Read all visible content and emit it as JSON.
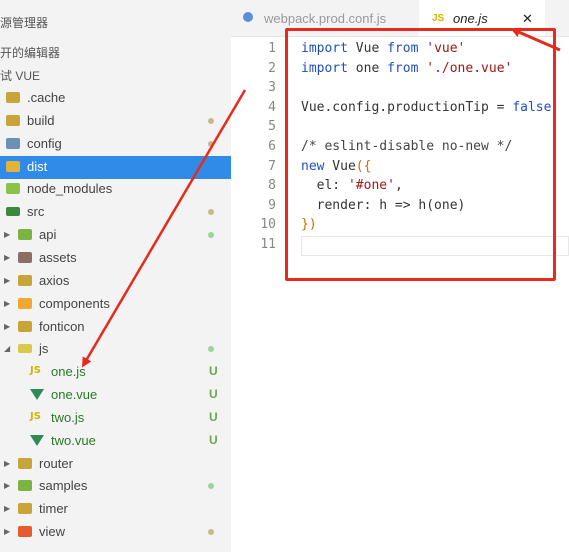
{
  "sidebar": {
    "header_title": "源管理器",
    "open_editors": "开的编辑器",
    "project": "试 VUE",
    "items": [
      {
        "label": ".cache",
        "depth": 0,
        "kind": "folder",
        "color": "#c9a43a"
      },
      {
        "label": "build",
        "depth": 0,
        "kind": "folder",
        "color": "#c9a43a",
        "status": "dot-y"
      },
      {
        "label": "config",
        "depth": 0,
        "kind": "folder",
        "color": "#6b8fb5",
        "status": "dot-y"
      },
      {
        "label": "dist",
        "depth": 0,
        "kind": "folder",
        "color": "#e0b33a",
        "selected": true
      },
      {
        "label": "node_modules",
        "depth": 0,
        "kind": "folder",
        "color": "#8bc34a"
      },
      {
        "label": "src",
        "depth": 0,
        "kind": "folder-open",
        "color": "#3b8a3b",
        "status": "dot-y"
      },
      {
        "label": "api",
        "depth": 1,
        "kind": "folder",
        "color": "#7cb342",
        "status": "dot-g"
      },
      {
        "label": "assets",
        "depth": 1,
        "kind": "folder",
        "color": "#8d6e63"
      },
      {
        "label": "axios",
        "depth": 1,
        "kind": "folder",
        "color": "#c9a43a"
      },
      {
        "label": "components",
        "depth": 1,
        "kind": "folder",
        "color": "#f0a830"
      },
      {
        "label": "fonticon",
        "depth": 1,
        "kind": "folder",
        "color": "#c9a43a"
      },
      {
        "label": "js",
        "depth": 1,
        "kind": "folder-open",
        "color": "#d9c84a",
        "status": "dot-g"
      },
      {
        "label": "one.js",
        "depth": 2,
        "kind": "js",
        "status": "U"
      },
      {
        "label": "one.vue",
        "depth": 2,
        "kind": "vue",
        "status": "U"
      },
      {
        "label": "two.js",
        "depth": 2,
        "kind": "js",
        "status": "U"
      },
      {
        "label": "two.vue",
        "depth": 2,
        "kind": "vue",
        "status": "U"
      },
      {
        "label": "router",
        "depth": 1,
        "kind": "folder",
        "color": "#c9a43a"
      },
      {
        "label": "samples",
        "depth": 1,
        "kind": "folder",
        "color": "#7cb342",
        "status": "dot-g"
      },
      {
        "label": "timer",
        "depth": 1,
        "kind": "folder",
        "color": "#c9a43a"
      },
      {
        "label": "view",
        "depth": 1,
        "kind": "folder",
        "color": "#e65c2e",
        "status": "dot-y"
      }
    ]
  },
  "tabs": [
    {
      "label": "webpack.prod.conf.js",
      "active": false
    },
    {
      "label": "one.js",
      "active": true,
      "prefix": "JS",
      "close": "✕"
    }
  ],
  "editor": {
    "line_numbers": [
      "1",
      "2",
      "3",
      "4",
      "5",
      "6",
      "7",
      "8",
      "9",
      "10",
      "11"
    ],
    "lines": [
      [
        {
          "t": "import",
          "c": "kw"
        },
        {
          "t": " Vue ",
          "c": ""
        },
        {
          "t": "from",
          "c": "kw"
        },
        {
          "t": " ",
          "c": ""
        },
        {
          "t": "'vue'",
          "c": "str"
        }
      ],
      [
        {
          "t": "import",
          "c": "kw"
        },
        {
          "t": " one ",
          "c": ""
        },
        {
          "t": "from",
          "c": "kw"
        },
        {
          "t": " ",
          "c": ""
        },
        {
          "t": "'./one.vue'",
          "c": "str"
        }
      ],
      [],
      [
        {
          "t": "Vue.config.productionTip = ",
          "c": ""
        },
        {
          "t": "false",
          "c": "kw"
        }
      ],
      [],
      [
        {
          "t": "/* eslint-disable no-new */",
          "c": "cmt"
        }
      ],
      [
        {
          "t": "new",
          "c": "kw"
        },
        {
          "t": " Vue",
          "c": ""
        },
        {
          "t": "({",
          "c": "br"
        }
      ],
      [
        {
          "t": "  el: ",
          "c": ""
        },
        {
          "t": "'#one'",
          "c": "str"
        },
        {
          "t": ",",
          "c": ""
        }
      ],
      [
        {
          "t": "  render: h => h(one)",
          "c": ""
        }
      ],
      [
        {
          "t": "})",
          "c": "br"
        }
      ],
      []
    ]
  },
  "colors": {
    "accent_selection": "#2f8ae8",
    "annotation_red": "#e62b1e"
  }
}
